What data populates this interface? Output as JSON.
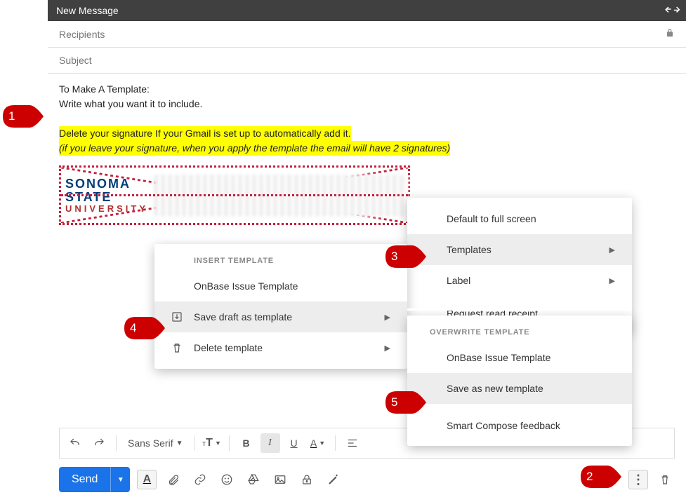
{
  "header": {
    "title": "New Message"
  },
  "fields": {
    "recipients_placeholder": "Recipients",
    "subject_placeholder": "Subject"
  },
  "body": {
    "line1": "To Make A Template:",
    "line2": "Write what you want it to include.",
    "hl1": "Delete your signature If your Gmail is set up to automatically add it.",
    "hl2": "(if you leave your signature, when you apply the template the email will have 2 signatures)"
  },
  "signature_logo": {
    "l1": "SONOMA",
    "l2": "STATE",
    "l3": "UNIVERSITY"
  },
  "format_bar": {
    "font": "Sans Serif",
    "bold": "B",
    "italic": "I",
    "underline": "U",
    "color": "A"
  },
  "action_bar": {
    "send": "Send"
  },
  "menu_options": {
    "default_full": "Default to full screen",
    "templates": "Templates",
    "label": "Label",
    "read_receipt": "Request read receipt",
    "smart_compose": "Smart Compose feedback"
  },
  "template_menu": {
    "insert_hdr": "INSERT TEMPLATE",
    "onbase": "OnBase Issue Template",
    "save_draft": "Save draft as template",
    "delete": "Delete template"
  },
  "overwrite_menu": {
    "hdr": "OVERWRITE TEMPLATE",
    "onbase": "OnBase Issue Template",
    "save_new": "Save as new template"
  },
  "callouts": {
    "c1": "1",
    "c2": "2",
    "c3": "3",
    "c4": "4",
    "c5": "5"
  }
}
